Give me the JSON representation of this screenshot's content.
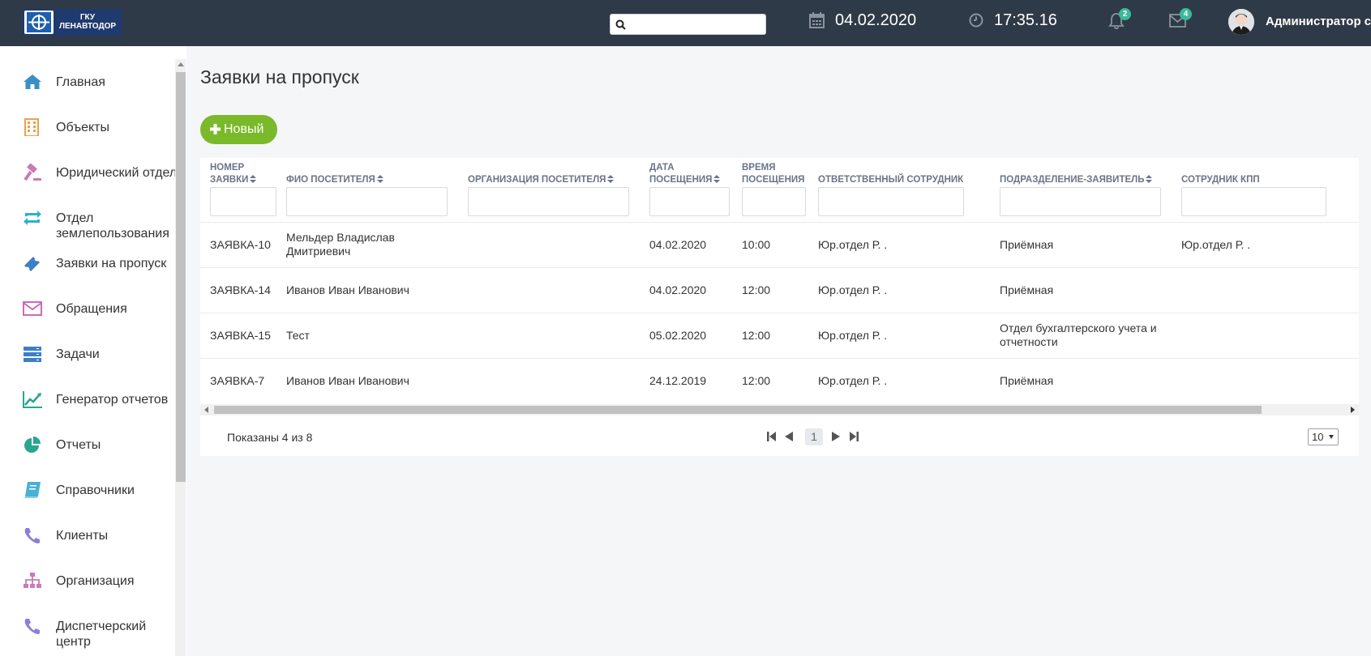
{
  "header": {
    "logo_text": "ГКУ ЛЕНАВТОДОР",
    "search_placeholder": "",
    "date": "04.02.2020",
    "time": "17:35.16",
    "notifications_count": "2",
    "messages_count": "4",
    "user_name": "Администратор с. ."
  },
  "sidebar": {
    "items": [
      {
        "label": "Главная",
        "icon": "home-icon",
        "color": "#3a8fc7"
      },
      {
        "label": "Объекты",
        "icon": "building-icon",
        "color": "#f0a04b"
      },
      {
        "label": "Юридический отдел",
        "icon": "gavel-icon",
        "color": "#c97bb8"
      },
      {
        "label": "Отдел землепользования",
        "icon": "exchange-icon",
        "color": "#2ab3c7"
      },
      {
        "label": "Заявки на пропуск",
        "icon": "ticket-icon",
        "color": "#3a7fc7"
      },
      {
        "label": "Обращения",
        "icon": "envelope-icon",
        "color": "#c96bb8"
      },
      {
        "label": "Задачи",
        "icon": "server-icon",
        "color": "#3a7fc7"
      },
      {
        "label": "Генератор отчетов",
        "icon": "line-chart-icon",
        "color": "#2aa58f"
      },
      {
        "label": "Отчеты",
        "icon": "pie-chart-icon",
        "color": "#2aa58f"
      },
      {
        "label": "Справочники",
        "icon": "book-icon",
        "color": "#4ab0d6"
      },
      {
        "label": "Клиенты",
        "icon": "phone-icon",
        "color": "#8b7fd6"
      },
      {
        "label": "Организация",
        "icon": "sitemap-icon",
        "color": "#c97bb8"
      },
      {
        "label": "Диспетчерский центр",
        "icon": "phone-icon",
        "color": "#8b7fd6"
      }
    ]
  },
  "main": {
    "title": "Заявки на пропуск",
    "new_button": "Новый"
  },
  "table": {
    "columns": [
      "НОМЕР ЗАЯВКИ",
      "ФИО ПОСЕТИТЕЛЯ",
      "ОРГАНИЗАЦИЯ ПОСЕТИТЕЛЯ",
      "ДАТА ПОСЕЩЕНИЯ",
      "ВРЕМЯ ПОСЕЩЕНИЯ",
      "ОТВЕТСТВЕННЫЙ СОТРУДНИК",
      "ПОДРАЗДЕЛЕНИЕ-ЗАЯВИТЕЛЬ",
      "СОТРУДНИК КПП"
    ],
    "rows": [
      {
        "number": "ЗАЯВКА-10",
        "visitor": "Мельдер Владислав Дмитриевич",
        "organization": "",
        "date": "04.02.2020",
        "time": "10:00",
        "responsible": "Юр.отдел Р. .",
        "department": "Приёмная",
        "checkpoint": "Юр.отдел Р. ."
      },
      {
        "number": "ЗАЯВКА-14",
        "visitor": "Иванов Иван Иванович",
        "organization": "",
        "date": "04.02.2020",
        "time": "12:00",
        "responsible": "Юр.отдел Р. .",
        "department": "Приёмная",
        "checkpoint": ""
      },
      {
        "number": "ЗАЯВКА-15",
        "visitor": "Тест",
        "organization": "",
        "date": "05.02.2020",
        "time": "12:00",
        "responsible": "Юр.отдел Р. .",
        "department": "Отдел бухгалтерского учета и отчетности",
        "checkpoint": ""
      },
      {
        "number": "ЗАЯВКА-7",
        "visitor": "Иванов Иван Иванович",
        "organization": "",
        "date": "24.12.2019",
        "time": "12:00",
        "responsible": "Юр.отдел Р. .",
        "department": "Приёмная",
        "checkpoint": ""
      }
    ],
    "footer": {
      "shown_text": "Показаны 4 из 8",
      "current_page": "1",
      "page_size": "10"
    }
  },
  "colors": {
    "topbar": "#2f3a48",
    "accent_green": "#7ab929",
    "badge": "#3cb99c"
  }
}
